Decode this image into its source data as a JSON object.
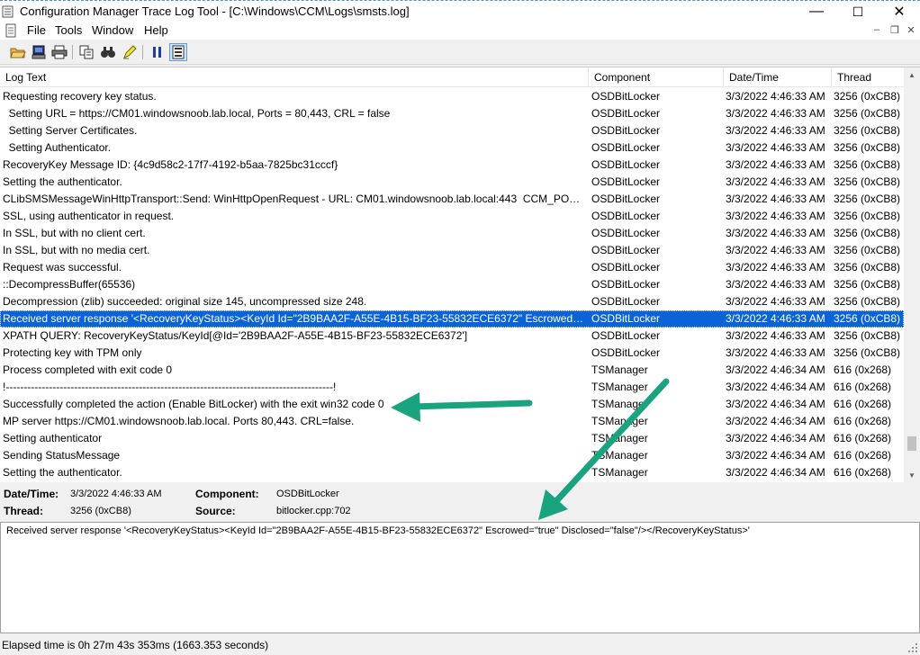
{
  "window": {
    "title": "Configuration Manager Trace Log Tool - [C:\\Windows\\CCM\\Logs\\smsts.log]",
    "controls": {
      "minimize": "—",
      "maximize": "☐",
      "close": "✕"
    }
  },
  "menu": {
    "items": [
      "File",
      "Tools",
      "Window",
      "Help"
    ],
    "mdi_controls": {
      "minimize": "–",
      "restore": "❐",
      "close": "✕"
    }
  },
  "toolbar": {
    "buttons": [
      "open-icon",
      "open-on-server-icon",
      "print-icon",
      "copy-icon",
      "find-icon",
      "highlight-icon",
      "pause-icon",
      "error-lookup-icon"
    ]
  },
  "list": {
    "columns": [
      "Log Text",
      "Component",
      "Date/Time",
      "Thread"
    ],
    "rows": [
      [
        "Requesting recovery key status.",
        "OSDBitLocker",
        "3/3/2022 4:46:33 AM",
        "3256 (0xCB8)"
      ],
      [
        "  Setting URL = https://CM01.windowsnoob.lab.local, Ports = 80,443, CRL = false",
        "OSDBitLocker",
        "3/3/2022 4:46:33 AM",
        "3256 (0xCB8)"
      ],
      [
        "  Setting Server Certificates.",
        "OSDBitLocker",
        "3/3/2022 4:46:33 AM",
        "3256 (0xCB8)"
      ],
      [
        "  Setting Authenticator.",
        "OSDBitLocker",
        "3/3/2022 4:46:33 AM",
        "3256 (0xCB8)"
      ],
      [
        "RecoveryKey Message ID: {4c9d58c2-17f7-4192-b5aa-7825bc31cccf}",
        "OSDBitLocker",
        "3/3/2022 4:46:33 AM",
        "3256 (0xCB8)"
      ],
      [
        "Setting the authenticator.",
        "OSDBitLocker",
        "3/3/2022 4:46:33 AM",
        "3256 (0xCB8)"
      ],
      [
        "CLibSMSMessageWinHttpTransport::Send: WinHttpOpenRequest - URL: CM01.windowsnoob.lab.local:443  CCM_POST /c...",
        "OSDBitLocker",
        "3/3/2022 4:46:33 AM",
        "3256 (0xCB8)"
      ],
      [
        "SSL, using authenticator in request.",
        "OSDBitLocker",
        "3/3/2022 4:46:33 AM",
        "3256 (0xCB8)"
      ],
      [
        "In SSL, but with no client cert.",
        "OSDBitLocker",
        "3/3/2022 4:46:33 AM",
        "3256 (0xCB8)"
      ],
      [
        "In SSL, but with no media cert.",
        "OSDBitLocker",
        "3/3/2022 4:46:33 AM",
        "3256 (0xCB8)"
      ],
      [
        "Request was successful.",
        "OSDBitLocker",
        "3/3/2022 4:46:33 AM",
        "3256 (0xCB8)"
      ],
      [
        "::DecompressBuffer(65536)",
        "OSDBitLocker",
        "3/3/2022 4:46:33 AM",
        "3256 (0xCB8)"
      ],
      [
        "Decompression (zlib) succeeded: original size 145, uncompressed size 248.",
        "OSDBitLocker",
        "3/3/2022 4:46:33 AM",
        "3256 (0xCB8)"
      ],
      [
        "Received server response '<RecoveryKeyStatus><KeyId Id=\"2B9BAA2F-A55E-4B15-BF23-55832ECE6372\" Escrowed=\"true\"...",
        "OSDBitLocker",
        "3/3/2022 4:46:33 AM",
        "3256 (0xCB8)"
      ],
      [
        "XPATH QUERY: RecoveryKeyStatus/KeyId[@Id='2B9BAA2F-A55E-4B15-BF23-55832ECE6372']",
        "OSDBitLocker",
        "3/3/2022 4:46:33 AM",
        "3256 (0xCB8)"
      ],
      [
        "Protecting key with TPM only",
        "OSDBitLocker",
        "3/3/2022 4:46:33 AM",
        "3256 (0xCB8)"
      ],
      [
        "Process completed with exit code 0",
        "TSManager",
        "3/3/2022 4:46:34 AM",
        "616 (0x268)"
      ],
      [
        "!-------------------------------------------------------------------------------------------!",
        "TSManager",
        "3/3/2022 4:46:34 AM",
        "616 (0x268)"
      ],
      [
        "Successfully completed the action (Enable BitLocker) with the exit win32 code 0",
        "TSManager",
        "3/3/2022 4:46:34 AM",
        "616 (0x268)"
      ],
      [
        "MP server https://CM01.windowsnoob.lab.local. Ports 80,443. CRL=false.",
        "TSManager",
        "3/3/2022 4:46:34 AM",
        "616 (0x268)"
      ],
      [
        "Setting authenticator",
        "TSManager",
        "3/3/2022 4:46:34 AM",
        "616 (0x268)"
      ],
      [
        "Sending StatusMessage",
        "TSManager",
        "3/3/2022 4:46:34 AM",
        "616 (0x268)"
      ],
      [
        "Setting the authenticator.",
        "TSManager",
        "3/3/2022 4:46:34 AM",
        "616 (0x268)"
      ]
    ],
    "selected_index": 13
  },
  "details": {
    "datetime_label": "Date/Time:",
    "datetime_value": "3/3/2022 4:46:33 AM",
    "component_label": "Component:",
    "component_value": "OSDBitLocker",
    "thread_label": "Thread:",
    "thread_value": "3256 (0xCB8)",
    "source_label": "Source:",
    "source_value": "bitlocker.cpp:702"
  },
  "message": {
    "text": "Received server response '<RecoveryKeyStatus><KeyId Id=\"2B9BAA2F-A55E-4B15-BF23-55832ECE6372\" Escrowed=\"true\" Disclosed=\"false\"/></RecoveryKeyStatus>'"
  },
  "status": {
    "text": "Elapsed time is 0h 27m 43s 353ms (1663.353 seconds)"
  },
  "colors": {
    "selection": "#0a64d8",
    "annotation_arrow": "#1aa37f"
  }
}
